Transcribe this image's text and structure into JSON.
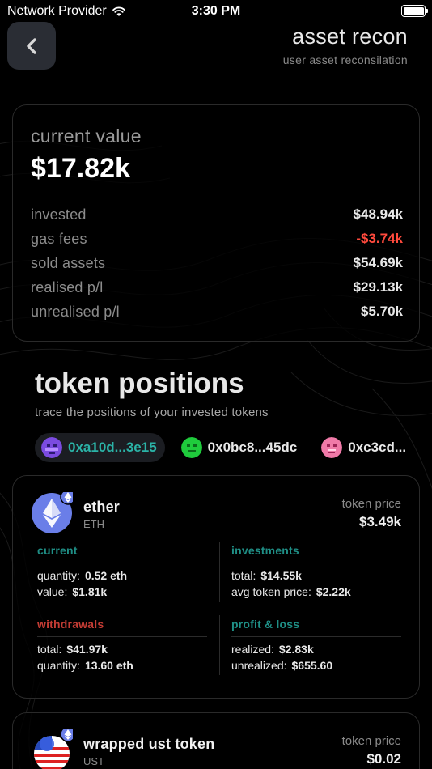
{
  "status_bar": {
    "carrier": "Network Provider",
    "time": "3:30 PM"
  },
  "header": {
    "title": "asset recon",
    "subtitle": "user asset reconsilation"
  },
  "summary": {
    "label": "current value",
    "value": "$17.82k",
    "rows": [
      {
        "label": "invested",
        "value": "$48.94k",
        "negative": false
      },
      {
        "label": "gas fees",
        "value": "-$3.74k",
        "negative": true
      },
      {
        "label": "sold assets",
        "value": "$54.69k",
        "negative": false
      },
      {
        "label": "realised p/l",
        "value": "$29.13k",
        "negative": false
      },
      {
        "label": "unrealised p/l",
        "value": "$5.70k",
        "negative": false
      }
    ]
  },
  "positions": {
    "title": "token positions",
    "subtitle": "trace the positions of your invested tokens",
    "wallets": [
      {
        "address": "0xa10d...3e15",
        "active": true,
        "icon": "purple-avatar-icon",
        "color": "#7b4be0"
      },
      {
        "address": "0x0bc8...45dc",
        "active": false,
        "icon": "green-avatar-icon",
        "color": "#1fcb3c"
      },
      {
        "address": "0xc3cd...",
        "active": false,
        "icon": "pink-avatar-icon",
        "color": "#f07aa8"
      }
    ]
  },
  "tokens": [
    {
      "name": "ether",
      "symbol": "ETH",
      "price_label": "token price",
      "price": "$3.49k",
      "current": {
        "title": "current",
        "quantity_label": "quantity:",
        "quantity": "0.52 eth",
        "value_label": "value:",
        "value": "$1.81k"
      },
      "investments": {
        "title": "investments",
        "total_label": "total:",
        "total": "$14.55k",
        "avg_label": "avg token price:",
        "avg": "$2.22k"
      },
      "withdrawals": {
        "title": "withdrawals",
        "total_label": "total:",
        "total": "$41.97k",
        "quantity_label": "quantity:",
        "quantity": "13.60 eth"
      },
      "pnl": {
        "title": "profit & loss",
        "realized_label": "realized:",
        "realized": "$2.83k",
        "unrealized_label": "unrealized:",
        "unrealized": "$655.60"
      }
    },
    {
      "name": "wrapped ust token",
      "symbol": "UST",
      "price_label": "token price",
      "price": "$0.02"
    }
  ],
  "colors": {
    "teal": "#1f8f86",
    "red": "#c43c34",
    "negative": "#ff4a3d",
    "active_wallet": "#2bb3a7"
  }
}
